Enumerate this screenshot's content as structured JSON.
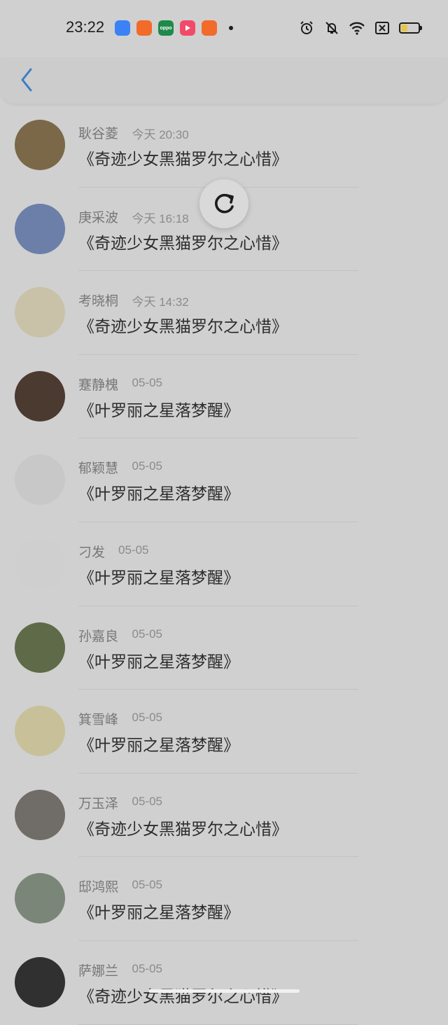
{
  "status_bar": {
    "time": "23:22",
    "apps": [
      {
        "icon": "blue-app-icon",
        "color": "#3b82f6",
        "label": ""
      },
      {
        "icon": "kuaishou-icon",
        "color": "#f26b2a",
        "label": ""
      },
      {
        "icon": "oppo-icon",
        "color": "#1e8a4a",
        "label": "oppo"
      },
      {
        "icon": "video-play-icon",
        "color": "#f24b6a",
        "label": ""
      },
      {
        "icon": "kuaishou-lite-icon",
        "color": "#f26b2a",
        "label": ""
      }
    ],
    "battery_level": 0.4
  },
  "nav": {
    "back_icon": "chevron-left-icon",
    "accent": "#3a7ec6"
  },
  "refresh_icon": "refresh-icon",
  "list": [
    {
      "name": "耿谷菱",
      "time": "今天 20:30",
      "title": "《奇迹少女黑猫罗尔之心惜》",
      "avatar_color": "#7a6848"
    },
    {
      "name": "庚采波",
      "time": "今天 16:18",
      "title": "《奇迹少女黑猫罗尔之心惜》",
      "avatar_color": "#6b7fa8"
    },
    {
      "name": "考晓桐",
      "time": "今天 14:32",
      "title": "《奇迹少女黑猫罗尔之心惜》",
      "avatar_color": "#c9c2a8"
    },
    {
      "name": "蹇静槐",
      "time": "05-05",
      "title": "《叶罗丽之星落梦醒》",
      "avatar_color": "#4a3a30"
    },
    {
      "name": "郁颖慧",
      "time": "05-05",
      "title": "《叶罗丽之星落梦醒》",
      "avatar_color": "#c8c8c8"
    },
    {
      "name": "刁发",
      "time": "05-05",
      "title": "《叶罗丽之星落梦醒》",
      "avatar_color": "#cfcfcf"
    },
    {
      "name": "孙嘉良",
      "time": "05-05",
      "title": "《叶罗丽之星落梦醒》",
      "avatar_color": "#5e6a48"
    },
    {
      "name": "箕雪峰",
      "time": "05-05",
      "title": "《叶罗丽之星落梦醒》",
      "avatar_color": "#c8c098"
    },
    {
      "name": "万玉泽",
      "time": "05-05",
      "title": "《奇迹少女黑猫罗尔之心惜》",
      "avatar_color": "#706c68"
    },
    {
      "name": "邸鸿熙",
      "time": "05-05",
      "title": "《叶罗丽之星落梦醒》",
      "avatar_color": "#7a8678"
    },
    {
      "name": "萨娜兰",
      "time": "05-05",
      "title": "《奇迹少女黑猫罗尔之心惜》",
      "avatar_color": "#303030"
    }
  ]
}
